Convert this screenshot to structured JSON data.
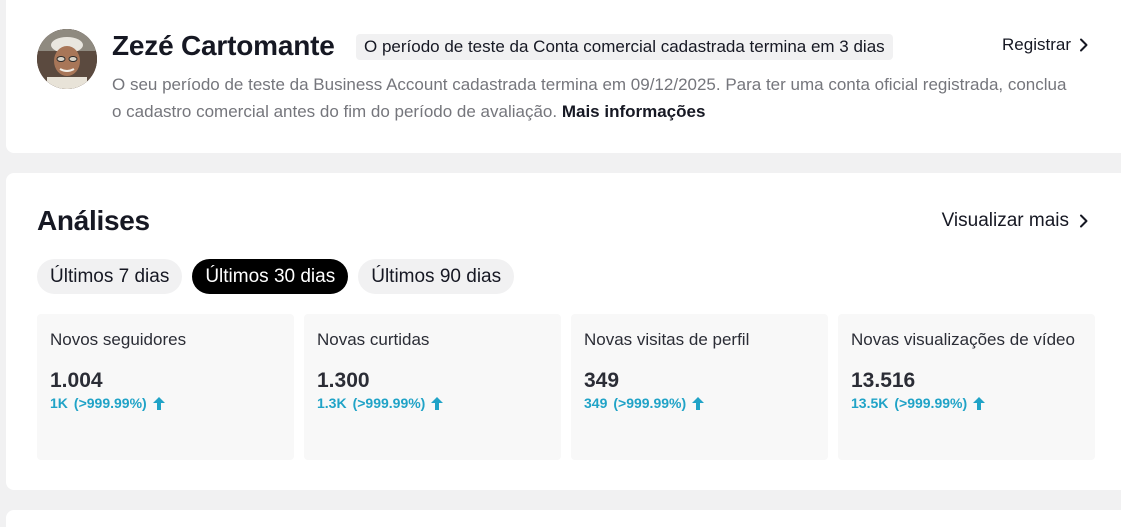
{
  "profile": {
    "name": "Zezé Cartomante",
    "trial_badge": "O período de teste da Conta comercial cadastrada termina em 3 dias",
    "register_label": "Registrar",
    "description": "O seu período de teste da Business Account cadastrada termina em 09/12/2025. Para ter uma conta oficial registrada, conclua o cadastro comercial antes do fim do período de avaliação.",
    "more_info_label": "Mais informações"
  },
  "analytics": {
    "title": "Análises",
    "view_more_label": "Visualizar mais",
    "tabs": [
      {
        "label": "Últimos 7 dias",
        "active": false
      },
      {
        "label": "Últimos 30 dias",
        "active": true
      },
      {
        "label": "Últimos 90 dias",
        "active": false
      }
    ],
    "stats": [
      {
        "label": "Novos seguidores",
        "value": "1.004",
        "delta": "1K",
        "percent": "(>999.99%)"
      },
      {
        "label": "Novas curtidas",
        "value": "1.300",
        "delta": "1.3K",
        "percent": "(>999.99%)"
      },
      {
        "label": "Novas visitas de perfil",
        "value": "349",
        "delta": "349",
        "percent": "(>999.99%)"
      },
      {
        "label": "Novas visualizações de vídeo",
        "value": "13.516",
        "delta": "13.5K",
        "percent": "(>999.99%)"
      }
    ]
  },
  "colors": {
    "accent_delta": "#20a3c7",
    "active_tab_bg": "#000000",
    "page_bg": "#f1f1f2"
  },
  "icons": {
    "register_arrow": "chevron-right-icon",
    "view_more_arrow": "chevron-right-icon",
    "delta_trend": "arrow-up-icon"
  }
}
